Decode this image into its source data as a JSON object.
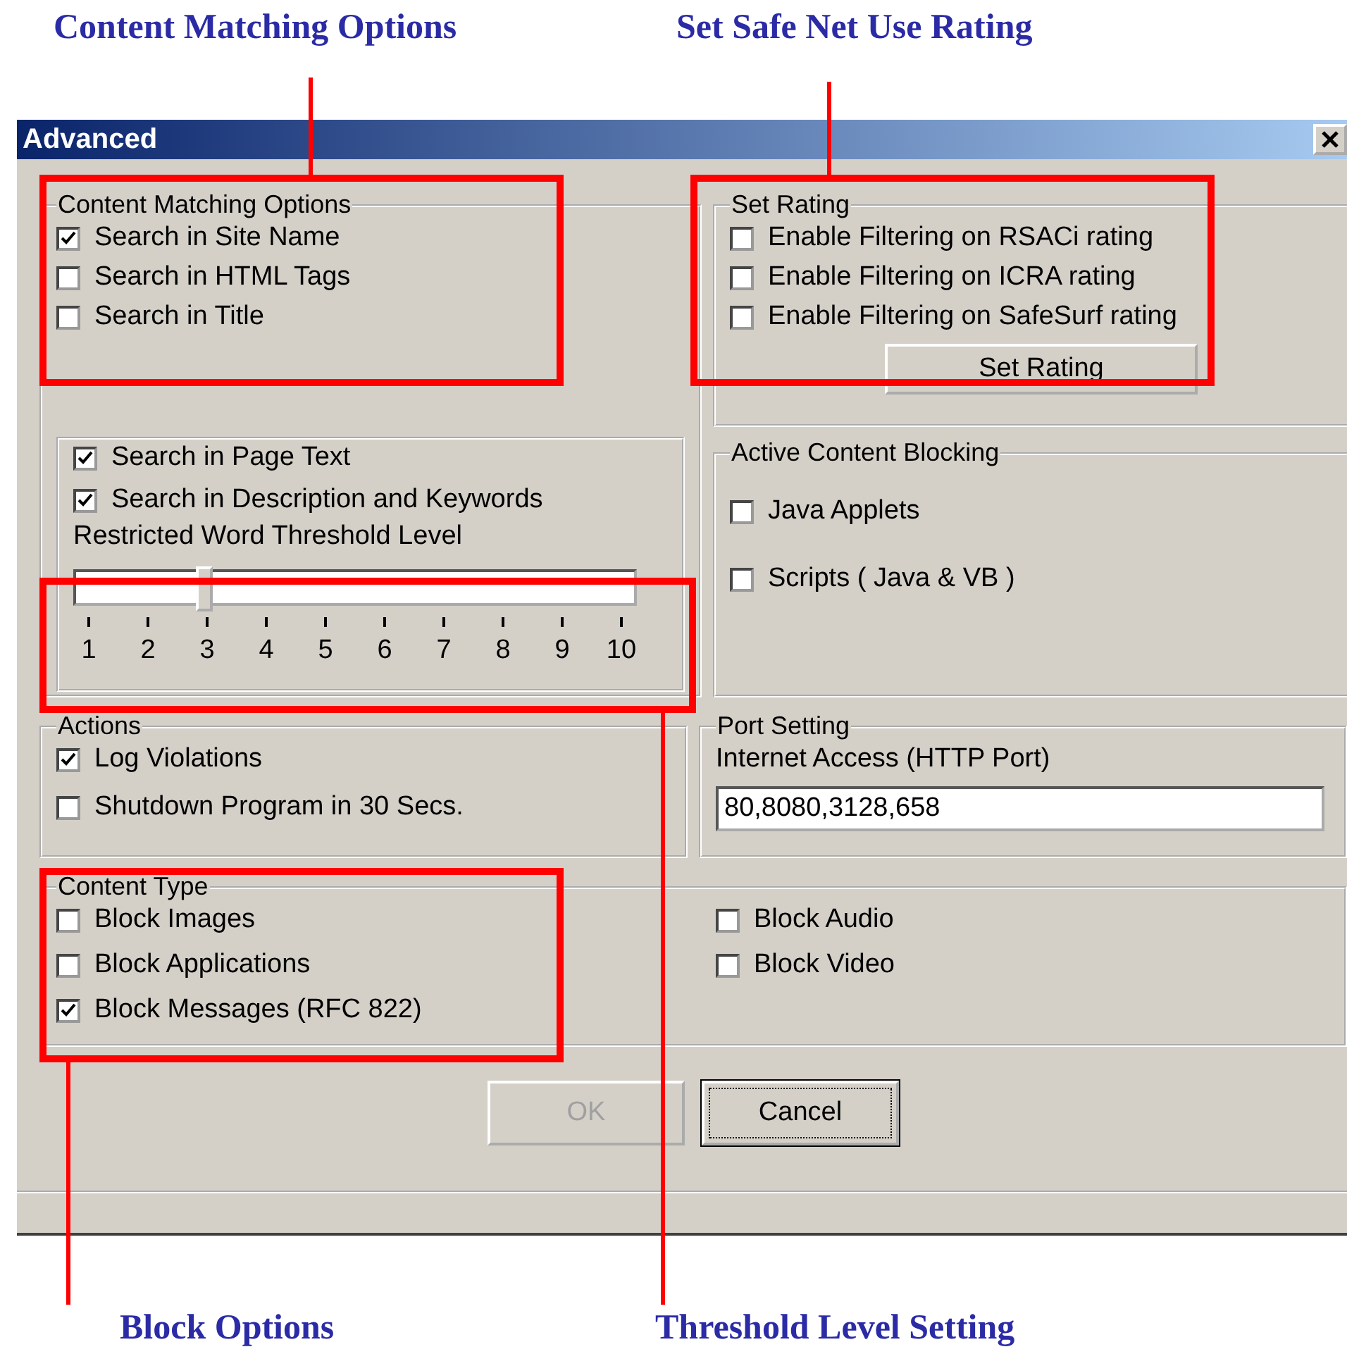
{
  "callouts_top": [
    {
      "text": "Content Matching Options"
    },
    {
      "text": "Set Safe Net Use Rating"
    }
  ],
  "window": {
    "title": "Advanced"
  },
  "content_matching": {
    "legend": "Content Matching Options",
    "options": [
      {
        "label": "Search in Site Name",
        "checked": true
      },
      {
        "label": "Search in HTML Tags",
        "checked": false
      },
      {
        "label": "Search in Title",
        "checked": false
      }
    ]
  },
  "text_search": {
    "options": [
      {
        "label": "Search in Page Text",
        "checked": true
      },
      {
        "label": "Search in Description and Keywords",
        "checked": true
      }
    ],
    "threshold_label": "Restricted Word Threshold Level",
    "slider": {
      "level": 0.222,
      "ticks": [
        "1",
        "2",
        "3",
        "4",
        "5",
        "6",
        "7",
        "8",
        "9",
        "10"
      ]
    }
  },
  "set_rating": {
    "legend": "Set Rating",
    "options": [
      {
        "label": "Enable Filtering on RSACi rating",
        "checked": false
      },
      {
        "label": "Enable Filtering on ICRA rating",
        "checked": false
      },
      {
        "label": "Enable Filtering on SafeSurf rating",
        "checked": false
      }
    ],
    "button": "Set Rating"
  },
  "active_content": {
    "legend": "Active Content Blocking",
    "options": [
      {
        "label": "Java Applets",
        "checked": false
      },
      {
        "label": "Scripts ( Java & VB )",
        "checked": false
      }
    ]
  },
  "actions": {
    "legend": "Actions",
    "options": [
      {
        "label": "Log Violations",
        "checked": true
      },
      {
        "label": "Shutdown Program in 30 Secs.",
        "checked": false
      }
    ]
  },
  "port_setting": {
    "legend": "Port Setting",
    "label": "Internet Access (HTTP Port)",
    "value": "80,8080,3128,658"
  },
  "content_type": {
    "legend": "Content Type",
    "left": [
      {
        "label": "Block Images",
        "checked": false
      },
      {
        "label": "Block Applications",
        "checked": false
      },
      {
        "label": "Block Messages (RFC 822)",
        "checked": true
      }
    ],
    "right": [
      {
        "label": "Block Audio",
        "checked": false
      },
      {
        "label": "Block Video",
        "checked": false
      }
    ]
  },
  "buttons": [
    {
      "label": "OK",
      "disabled": true,
      "focused": false
    },
    {
      "label": "Cancel",
      "disabled": false,
      "focused": true
    }
  ],
  "callouts_bottom": [
    {
      "text": "Block Options"
    },
    {
      "text": "Threshold Level Setting"
    }
  ]
}
